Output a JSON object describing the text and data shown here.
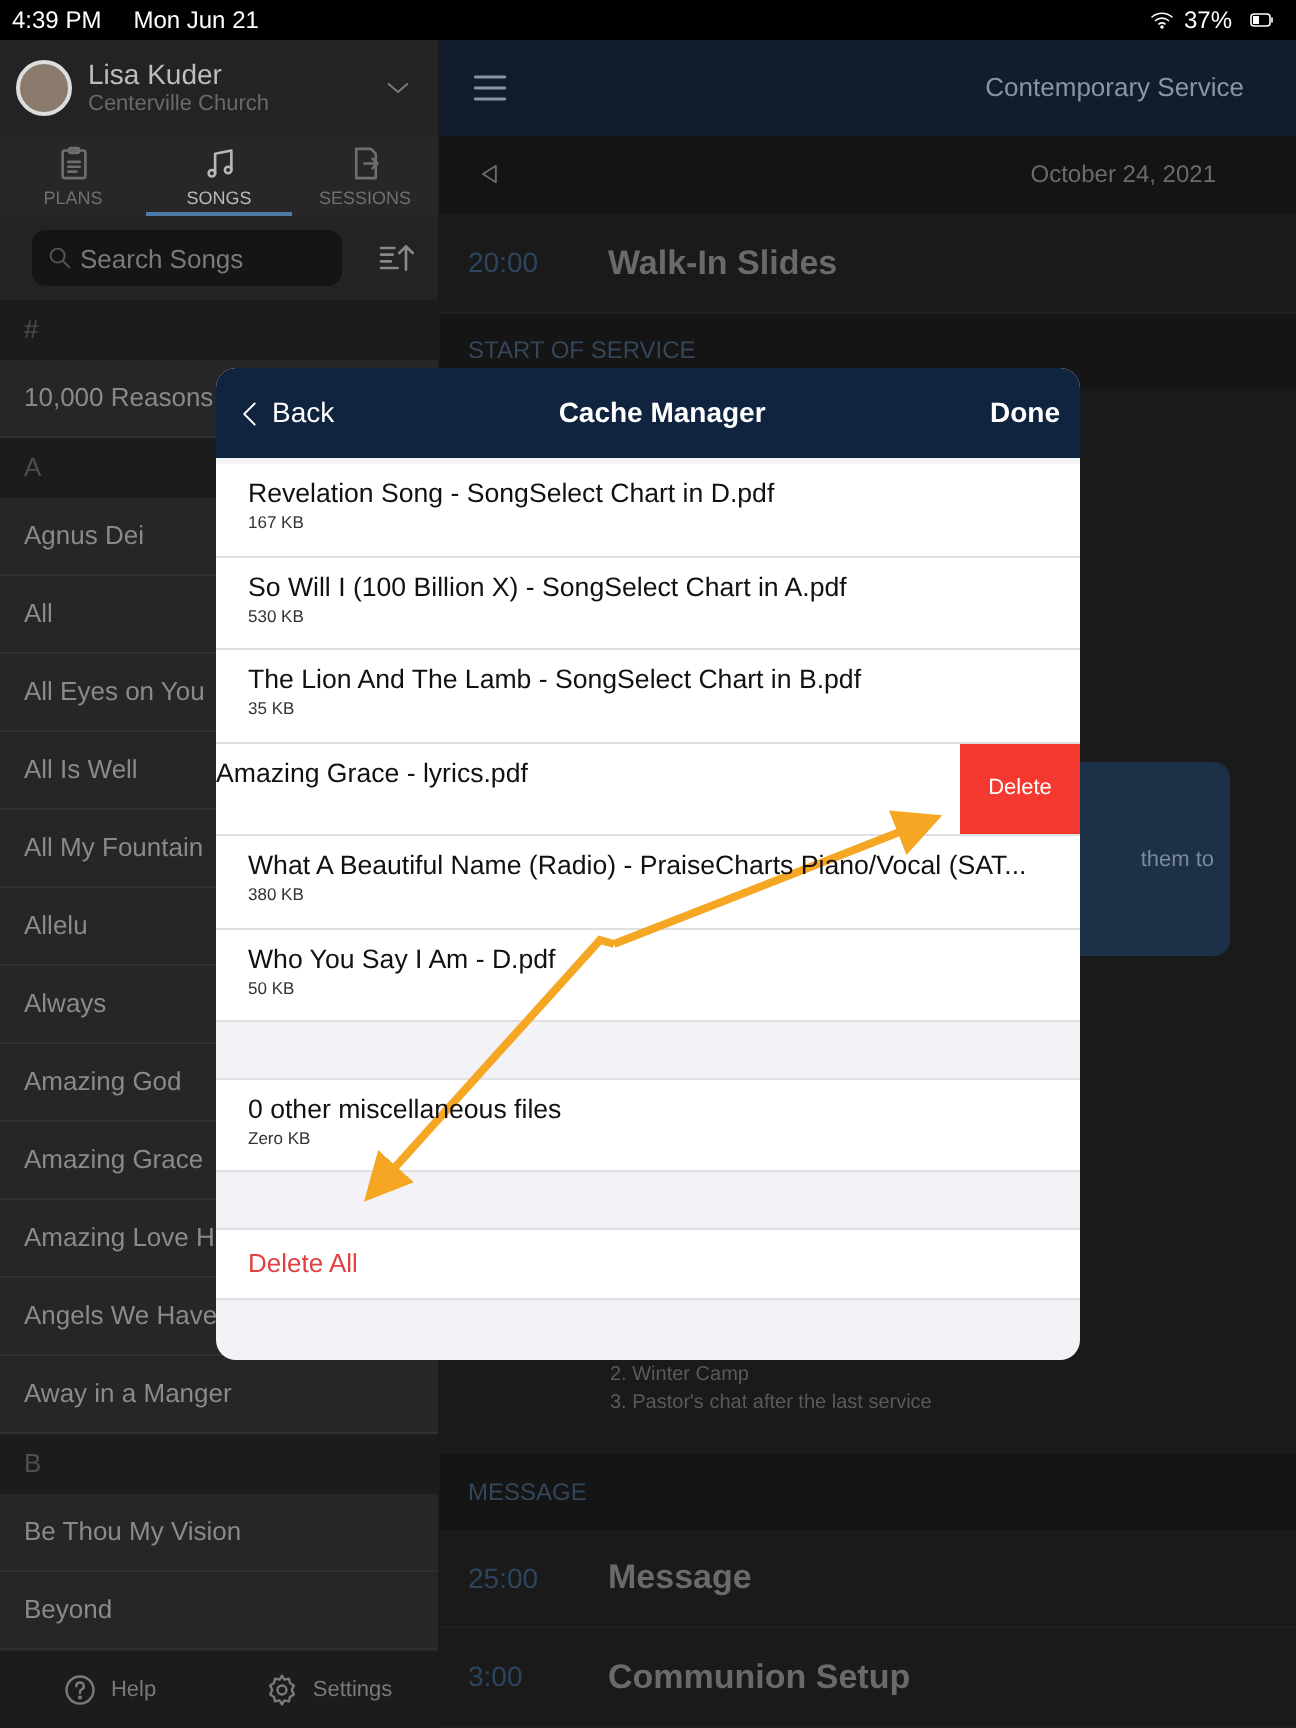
{
  "status_bar": {
    "time": "4:39 PM",
    "date": "Mon Jun 21",
    "battery": "37%"
  },
  "sidebar": {
    "user": {
      "name": "Lisa Kuder",
      "org": "Centerville Church"
    },
    "tabs": [
      {
        "label": "PLANS",
        "selected": false
      },
      {
        "label": "SONGS",
        "selected": true
      },
      {
        "label": "SESSIONS",
        "selected": false
      }
    ],
    "search": {
      "placeholder": "Search Songs"
    },
    "songs": [
      {
        "kind": "section",
        "label": "#"
      },
      {
        "kind": "song",
        "label": "10,000 Reasons"
      },
      {
        "kind": "section",
        "label": "A"
      },
      {
        "kind": "song",
        "label": "Agnus Dei"
      },
      {
        "kind": "song",
        "label": "All"
      },
      {
        "kind": "song",
        "label": "All Eyes on You"
      },
      {
        "kind": "song",
        "label": "All Is Well"
      },
      {
        "kind": "song",
        "label": "All My Fountain"
      },
      {
        "kind": "song",
        "label": "Allelu"
      },
      {
        "kind": "song",
        "label": "Always"
      },
      {
        "kind": "song",
        "label": "Amazing God"
      },
      {
        "kind": "song",
        "label": "Amazing Grace"
      },
      {
        "kind": "song",
        "label": "Amazing Love H"
      },
      {
        "kind": "song",
        "label": "Angels We Have"
      },
      {
        "kind": "song",
        "label": "Away in a Manger"
      },
      {
        "kind": "section",
        "label": "B"
      },
      {
        "kind": "song",
        "label": "Be Thou My Vision"
      },
      {
        "kind": "song",
        "label": "Beyond"
      }
    ],
    "footer": [
      {
        "label": "Help"
      },
      {
        "label": "Settings"
      }
    ]
  },
  "main": {
    "title": "Contemporary Service",
    "date": "October 24, 2021",
    "rows": [
      {
        "kind": "item",
        "time": "20:00",
        "title": "Walk-In Slides"
      },
      {
        "kind": "section",
        "label": "START OF SERVICE"
      },
      {
        "kind": "card",
        "text": "them to"
      },
      {
        "kind": "notes",
        "lines": [
          "2. Winter Camp",
          "3. Pastor's chat after the last service"
        ]
      },
      {
        "kind": "section",
        "label": "MESSAGE"
      },
      {
        "kind": "item",
        "time": "25:00",
        "title": "Message"
      },
      {
        "kind": "item",
        "time": "3:00",
        "title": "Communion Setup"
      }
    ]
  },
  "modal": {
    "back": "Back",
    "title": "Cache Manager",
    "done": "Done",
    "delete_label": "Delete",
    "files": [
      {
        "name": "Revelation Song - SongSelect Chart in D.pdf",
        "size": "167 KB",
        "swiped": false
      },
      {
        "name": "So Will I (100 Billion X) - SongSelect Chart in A.pdf",
        "size": "530 KB",
        "swiped": false
      },
      {
        "name": "The Lion And The Lamb - SongSelect Chart in B.pdf",
        "size": "35 KB",
        "swiped": false
      },
      {
        "name": "Amazing Grace - lyrics.pdf",
        "swiped": true
      },
      {
        "name": "What A Beautiful Name (Radio) - PraiseCharts Piano/Vocal (SAT...",
        "size": "380 KB",
        "swiped": false
      },
      {
        "name": "Who You Say I Am - D.pdf",
        "size": "50 KB",
        "swiped": false
      }
    ],
    "misc": {
      "name": "0 other miscellaneous files",
      "size": "Zero KB"
    },
    "delete_all": "Delete All"
  }
}
